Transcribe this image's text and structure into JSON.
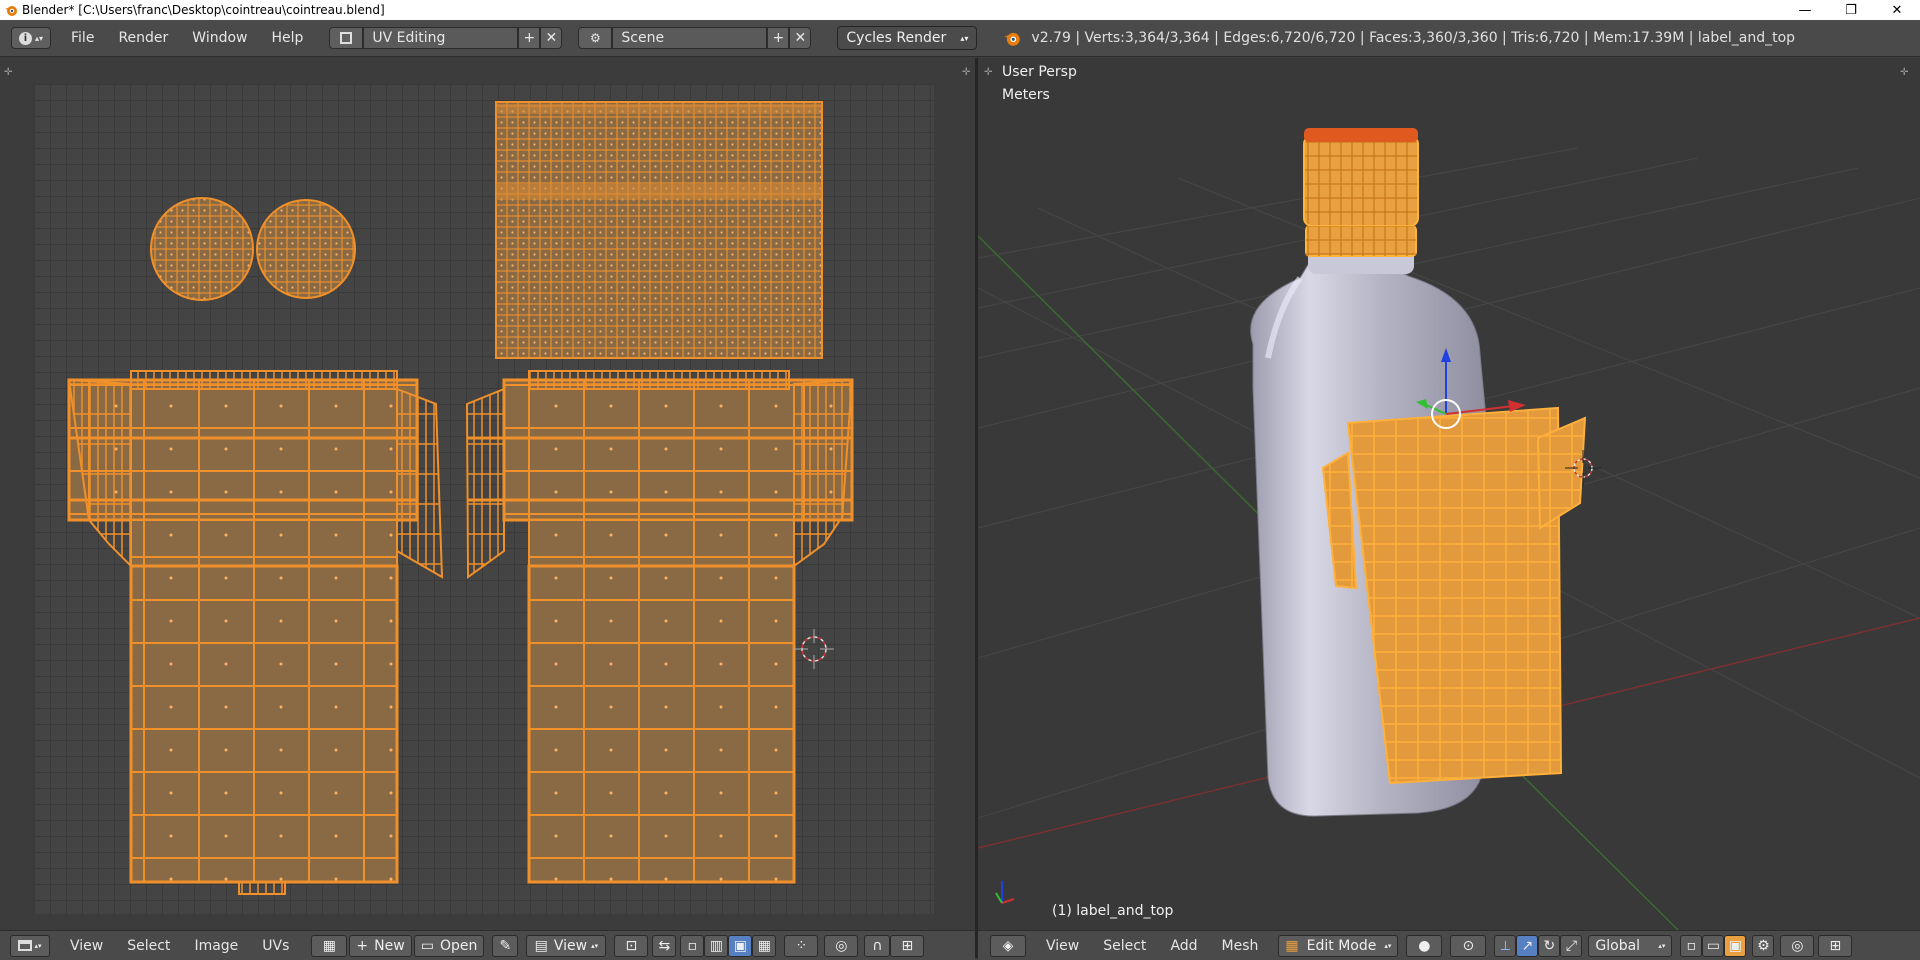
{
  "window": {
    "title": "Blender* [C:\\Users\\franc\\Desktop\\cointreau\\cointreau.blend]",
    "minimize": "—",
    "restore": "❐",
    "close": "✕"
  },
  "info_header": {
    "menus": [
      "File",
      "Render",
      "Window",
      "Help"
    ],
    "screen_layout": "UV Editing",
    "scene": "Scene",
    "render_engine": "Cycles Render",
    "stats": "v2.79 | Verts:3,364/3,364 | Edges:6,720/6,720 | Faces:3,360/3,360 | Tris:6,720 | Mem:17.39M | label_and_top"
  },
  "uv_editor": {
    "bottom_menus": [
      "View",
      "Select",
      "Image",
      "UVs"
    ],
    "new_label": "New",
    "open_label": "Open",
    "view_label": "View"
  },
  "viewport": {
    "view_name": "User Persp",
    "units": "Meters",
    "object_label": "(1) label_and_top",
    "bottom_menus": [
      "View",
      "Select",
      "Add",
      "Mesh"
    ],
    "mode": "Edit Mode",
    "orientation": "Global"
  },
  "colors": {
    "uv_orange": "#f0902a",
    "uv_fill": "#8a6a45",
    "axis_x": "#d03030",
    "axis_y": "#30c030",
    "axis_z": "#2040e0"
  }
}
